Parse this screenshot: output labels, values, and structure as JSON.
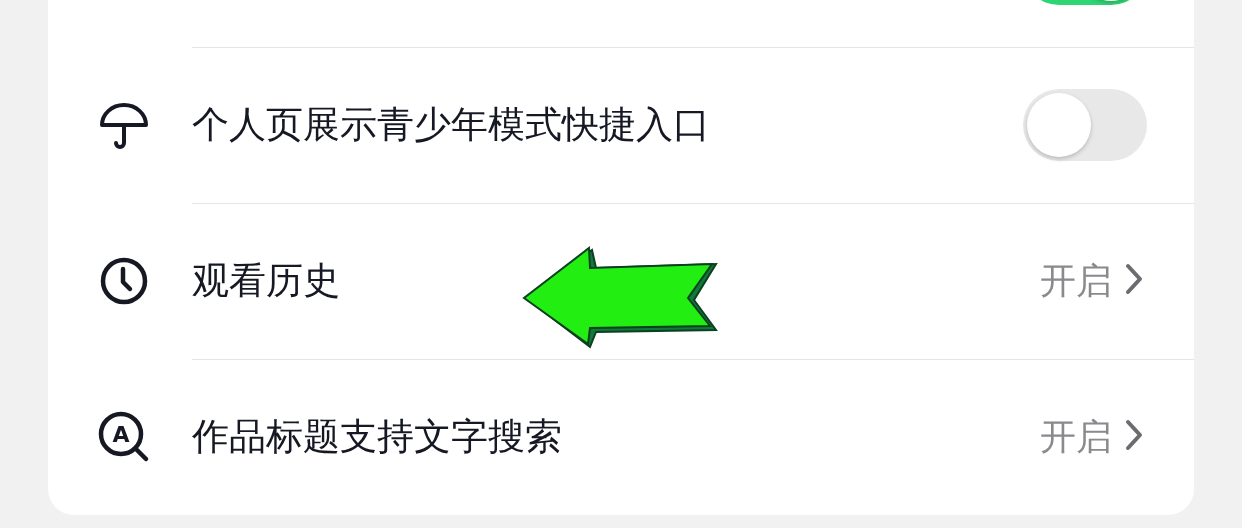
{
  "settings": {
    "rows": [
      {
        "kind": "toggle",
        "on": true
      },
      {
        "kind": "toggle",
        "label": "个人页展示青少年模式快捷入口",
        "on": false
      },
      {
        "kind": "link",
        "label": "观看历史",
        "value": "开启"
      },
      {
        "kind": "link",
        "icon_letter": "A",
        "label": "作品标题支持文字搜索",
        "value": "开启"
      }
    ]
  }
}
